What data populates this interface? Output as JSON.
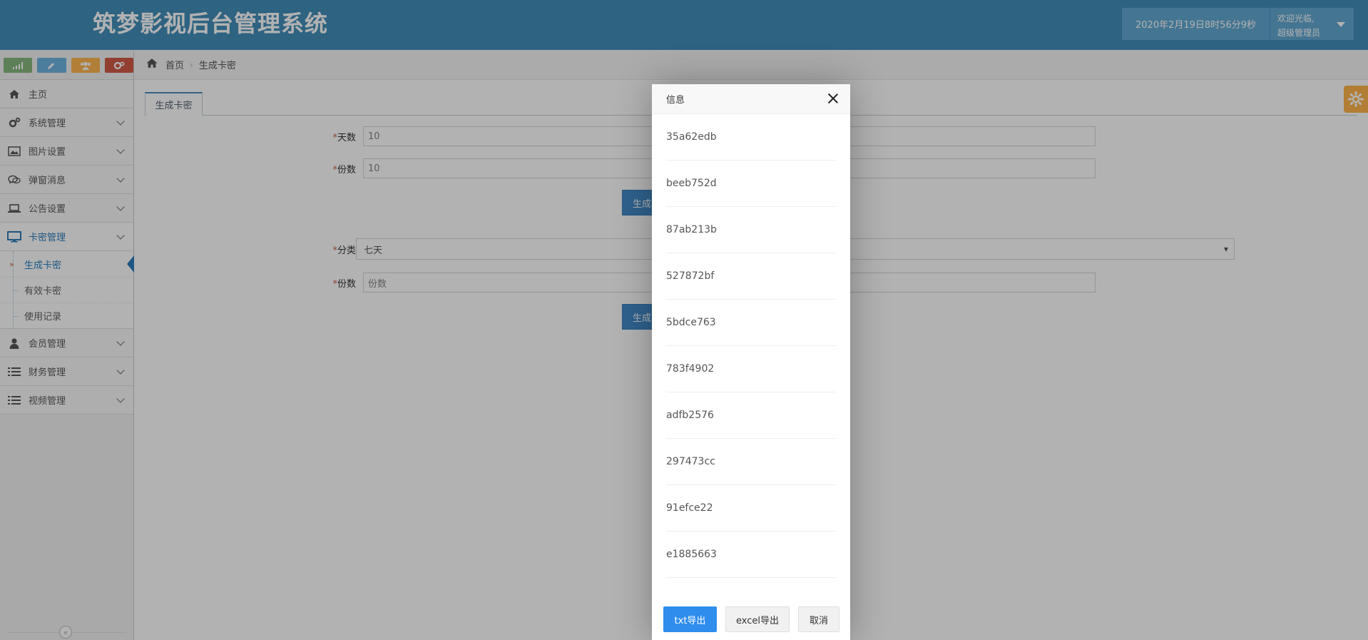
{
  "header": {
    "brand": "筑梦影视后台管理系统",
    "datetime": "2020年2月19日8时56分9秒",
    "welcome": "欢迎光临,",
    "user_role": "超级管理员"
  },
  "sidebar": {
    "items": [
      {
        "label": "主页",
        "icon": "home-icon"
      },
      {
        "label": "系统管理",
        "icon": "cogs-icon"
      },
      {
        "label": "图片设置",
        "icon": "picture-icon"
      },
      {
        "label": "弹窗消息",
        "icon": "comments-icon"
      },
      {
        "label": "公告设置",
        "icon": "laptop-icon"
      },
      {
        "label": "卡密管理",
        "icon": "desktop-icon"
      },
      {
        "label": "会员管理",
        "icon": "user-icon"
      },
      {
        "label": "财务管理",
        "icon": "list-icon"
      },
      {
        "label": "视频管理",
        "icon": "list-icon"
      }
    ],
    "submenu": [
      {
        "label": "生成卡密"
      },
      {
        "label": "有效卡密"
      },
      {
        "label": "使用记录"
      }
    ]
  },
  "breadcrumb": {
    "home": "首页",
    "current": "生成卡密"
  },
  "tab": {
    "label": "生成卡密"
  },
  "form": {
    "days_label": "天数",
    "days_value": "10",
    "count_label": "份数",
    "count_value": "10",
    "generate_label": "生成",
    "category_label": "分类",
    "category_value": "七天",
    "count2_label": "份数",
    "count2_placeholder": "份数",
    "generate2_label": "生成"
  },
  "dialog": {
    "title": "信息",
    "codes": [
      "35a62edb",
      "beeb752d",
      "87ab213b",
      "527872bf",
      "5bdce763",
      "783f4902",
      "adfb2576",
      "297473cc",
      "91efce22",
      "e1885663"
    ],
    "txt_export": "txt导出",
    "excel_export": "excel导出",
    "cancel": "取消"
  },
  "colors": {
    "header": "#438eb9",
    "accent": "#2b7dbc",
    "primary_button": "#2e8ded",
    "settings": "#ffb44b"
  }
}
